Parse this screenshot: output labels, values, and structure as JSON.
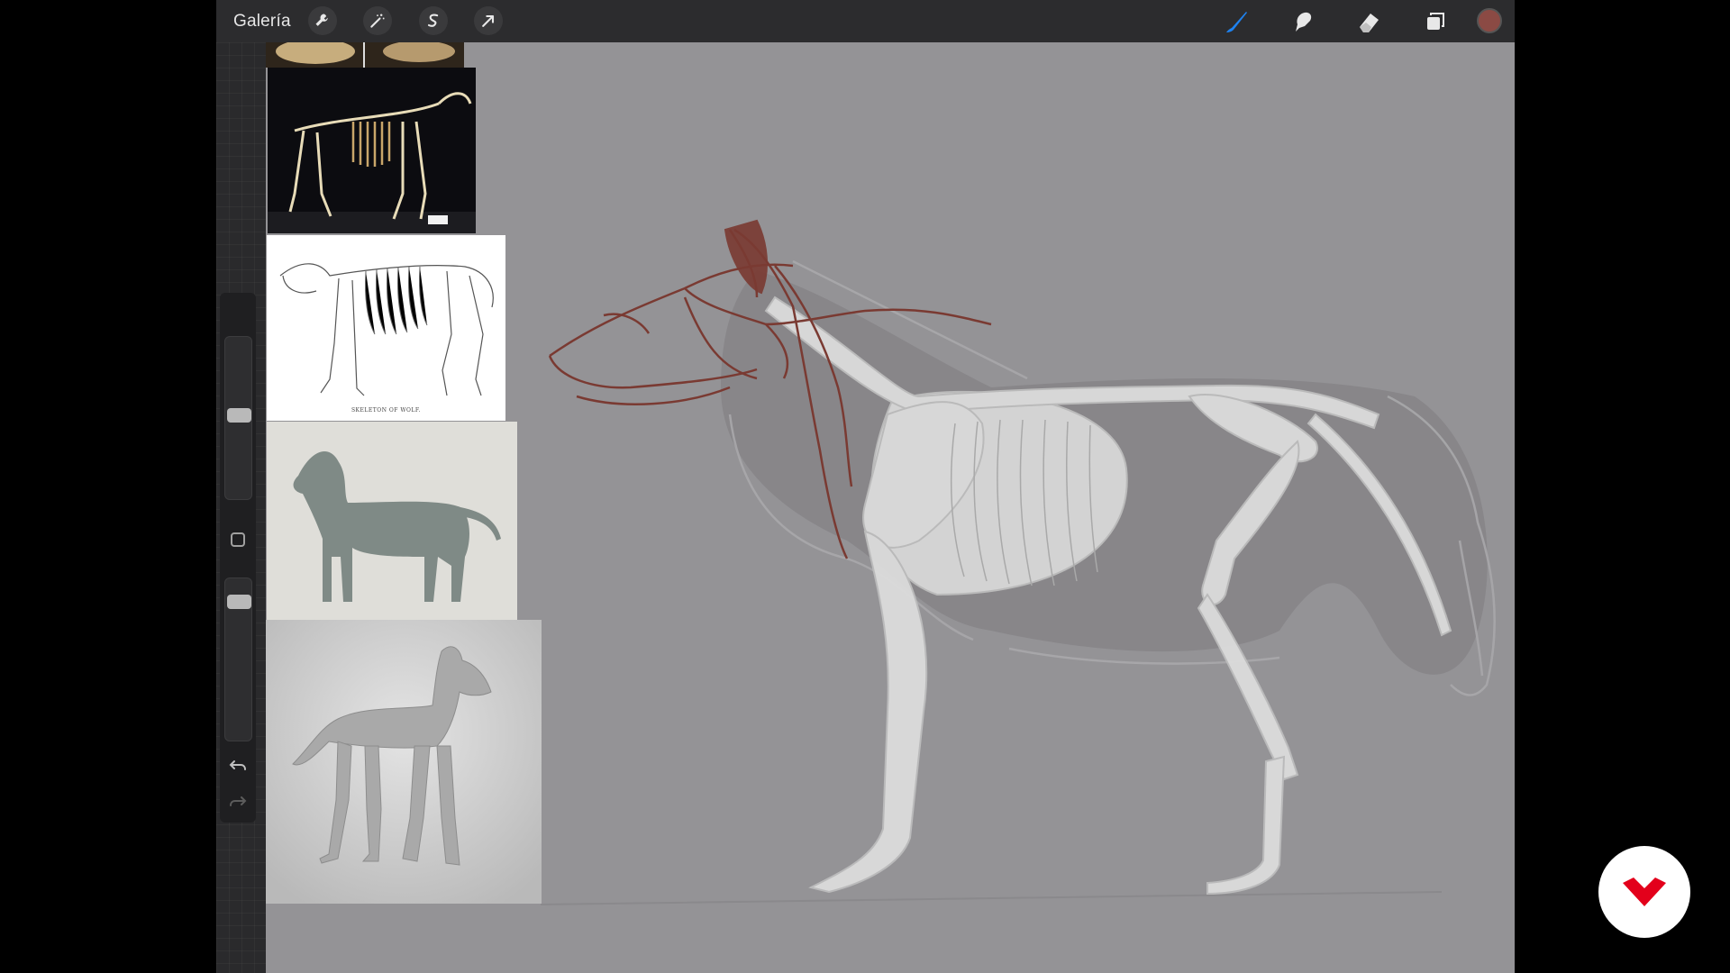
{
  "toolbar": {
    "gallery_label": "Galería",
    "left_tools": [
      "wrench-icon",
      "magic-wand-icon",
      "selection-s-icon",
      "transform-arrow-icon"
    ],
    "right_tools": [
      "brush-icon",
      "smudge-icon",
      "eraser-icon",
      "layers-icon"
    ],
    "active_tool": "brush-icon",
    "accent_color": "#1e82f0",
    "current_color": "#8b4a44"
  },
  "sidebar": {
    "brush_size_level": 0.52,
    "opacity_level": 0.1,
    "buttons": [
      "modify-square-button",
      "undo-icon",
      "redo-icon"
    ]
  },
  "canvas": {
    "background_color": "#949396",
    "sketch_line_color": "#c8c8c8",
    "muscle_line_color": "#7a3a32"
  },
  "references": [
    {
      "name": "skull-photo",
      "caption": ""
    },
    {
      "name": "skeleton-photo",
      "caption": ""
    },
    {
      "name": "skeleton-engraving",
      "caption": "SKELETON OF WOLF."
    },
    {
      "name": "muscle-model-photo",
      "caption": ""
    },
    {
      "name": "muscle-render",
      "caption": ""
    }
  ],
  "watermark": {
    "name": "domestika-logo",
    "color": "#e3001b"
  }
}
